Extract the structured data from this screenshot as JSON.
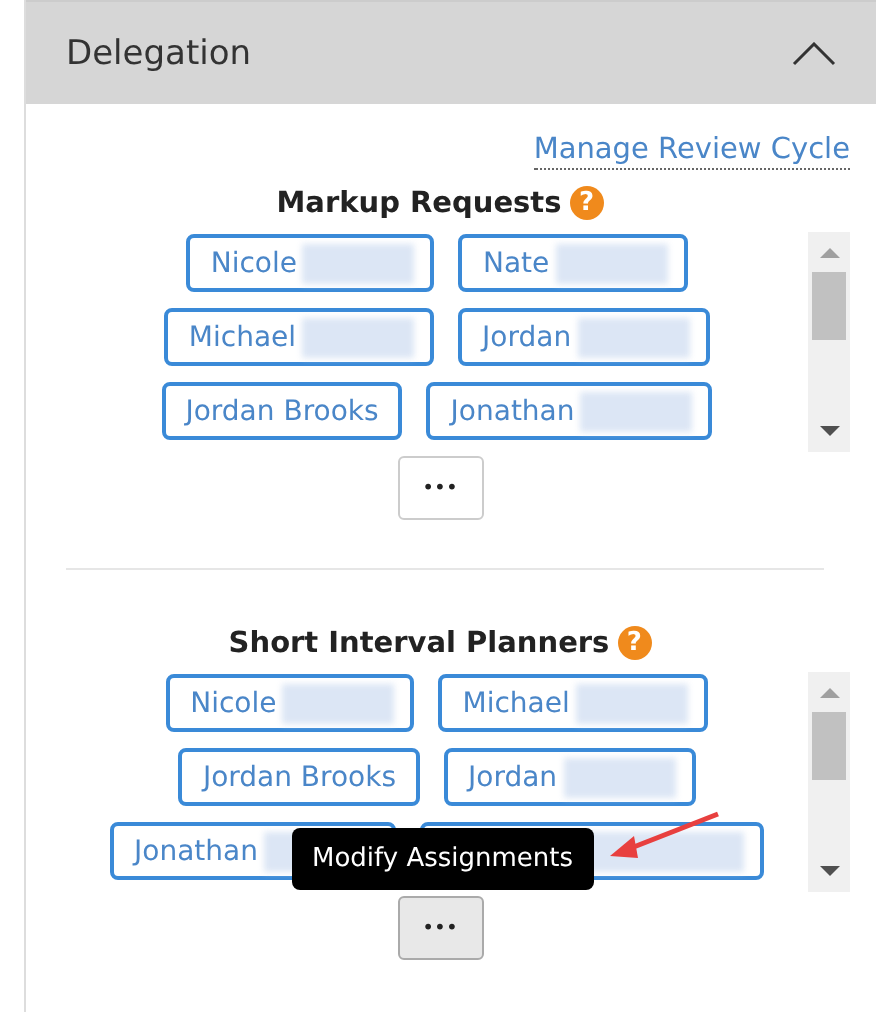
{
  "panel": {
    "title": "Delegation",
    "expanded": true
  },
  "link": "Manage Review Cycle",
  "sections": [
    {
      "title": "Markup Requests",
      "help": "?",
      "more": {
        "label": "•••",
        "pressed": false
      },
      "people": [
        {
          "name": "Nicole",
          "redacted": true
        },
        {
          "name": "Nate",
          "redacted": true
        },
        {
          "name": "Michael",
          "redacted": true
        },
        {
          "name": "Jordan",
          "redacted": true
        },
        {
          "name": "Jordan Brooks",
          "redacted": false
        },
        {
          "name": "Jonathan",
          "redacted": true
        }
      ]
    },
    {
      "title": "Short Interval Planners",
      "help": "?",
      "more": {
        "label": "•••",
        "pressed": true
      },
      "people": [
        {
          "name": "Nicole",
          "redacted": true
        },
        {
          "name": "Michael",
          "redacted": true
        },
        {
          "name": "Jordan Brooks",
          "redacted": false
        },
        {
          "name": "Jordan",
          "redacted": true
        },
        {
          "name": "Jonathan",
          "redacted": true
        },
        {
          "redacted": true
        }
      ]
    }
  ],
  "tooltip": "Modify Assignments"
}
